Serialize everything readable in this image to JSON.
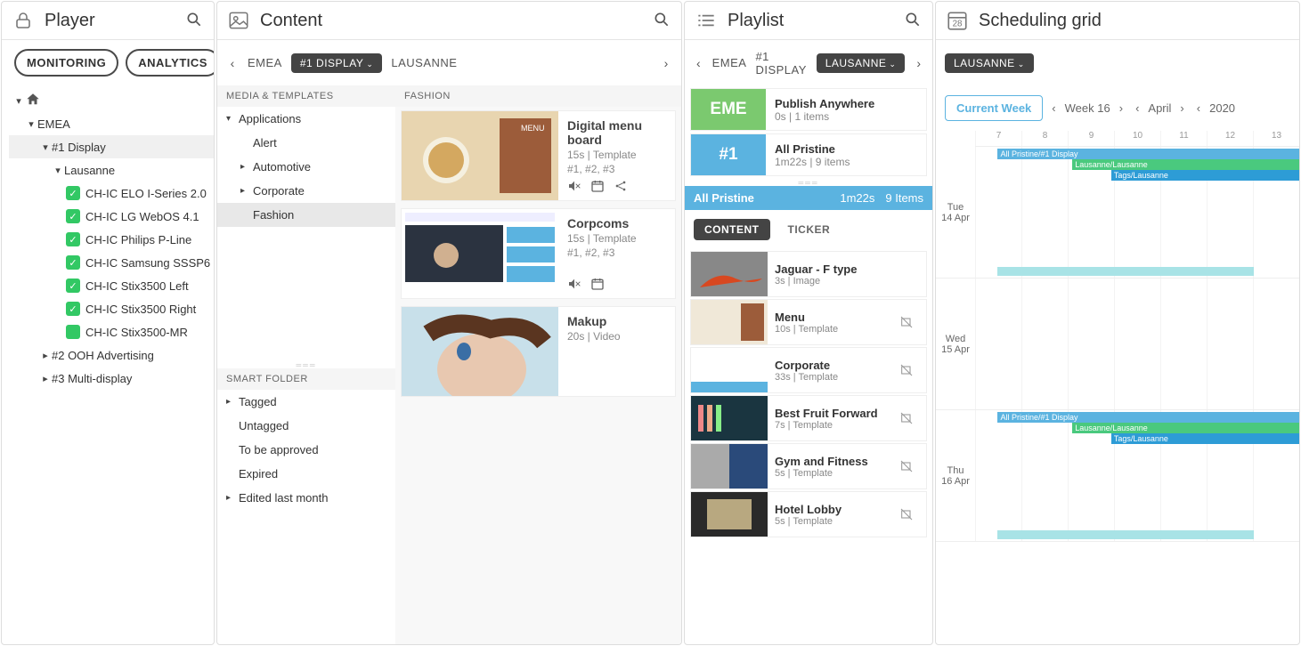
{
  "player": {
    "title": "Player",
    "monitoring": "MONITORING",
    "analytics": "ANALYTICS",
    "tree": {
      "emea": "EMEA",
      "d1": "#1 Display",
      "lausanne": "Lausanne",
      "devices": [
        "CH-IC ELO I-Series 2.0",
        "CH-IC LG WebOS 4.1",
        "CH-IC Philips P-Line",
        "CH-IC Samsung SSSP6",
        "CH-IC Stix3500 Left",
        "CH-IC Stix3500 Right",
        "CH-IC Stix3500-MR"
      ],
      "d2": "#2 OOH Advertising",
      "d3": "#3 Multi-display"
    }
  },
  "content": {
    "title": "Content",
    "crumbs": {
      "c1": "EMEA",
      "c2": "#1 DISPLAY",
      "c3": "LAUSANNE"
    },
    "sections": {
      "media": "MEDIA & TEMPLATES",
      "smart": "SMART FOLDER"
    },
    "media_folders": {
      "applications": "Applications",
      "alert": "Alert",
      "automotive": "Automotive",
      "corporate": "Corporate",
      "fashion": "Fashion"
    },
    "smart_folders": {
      "tagged": "Tagged",
      "untagged": "Untagged",
      "tobeapproved": "To be approved",
      "expired": "Expired",
      "edited": "Edited last month"
    },
    "fashion_hdr": "FASHION",
    "cards": [
      {
        "title": "Digital menu board",
        "meta1": "15s | Template",
        "meta2": "#1, #2, #3"
      },
      {
        "title": "Corpcoms",
        "meta1": "15s | Template",
        "meta2": "#1, #2, #3"
      },
      {
        "title": "Makup",
        "meta1": "20s | Video",
        "meta2": ""
      }
    ]
  },
  "playlist": {
    "title": "Playlist",
    "crumbs": {
      "c1": "EMEA",
      "c2": "#1 DISPLAY",
      "c3": "LAUSANNE"
    },
    "summary": [
      {
        "badge": "EME",
        "title": "Publish Anywhere",
        "meta": "0s | 1 items"
      },
      {
        "badge": "#1",
        "title": "All Pristine",
        "meta": "1m22s | 9 items"
      }
    ],
    "highlight": {
      "name": "All Pristine",
      "dur": "1m22s",
      "items": "9 Items"
    },
    "tabs": {
      "content": "CONTENT",
      "ticker": "TICKER"
    },
    "items": [
      {
        "title": "Jaguar - F type",
        "meta": "3s | Image"
      },
      {
        "title": "Menu",
        "meta": "10s | Template"
      },
      {
        "title": "Corporate",
        "meta": "33s | Template"
      },
      {
        "title": "Best Fruit Forward",
        "meta": "7s | Template"
      },
      {
        "title": "Gym and Fitness",
        "meta": "5s | Template"
      },
      {
        "title": "Hotel Lobby",
        "meta": "5s | Template"
      }
    ]
  },
  "grid": {
    "title": "Scheduling grid",
    "crumb": "LAUSANNE",
    "calnum": "28",
    "current_week": "Current Week",
    "week": "Week 16",
    "month": "April",
    "year": "2020",
    "hours": [
      "7",
      "8",
      "9",
      "10",
      "11",
      "12",
      "13"
    ],
    "days": [
      {
        "dow": "Tue",
        "date": "14 Apr"
      },
      {
        "dow": "Wed",
        "date": "15 Apr"
      },
      {
        "dow": "Thu",
        "date": "16 Apr"
      }
    ],
    "bands": {
      "b1": "All Pristine/#1 Display",
      "b2": "Lausanne/Lausanne",
      "b3": "Tags/Lausanne"
    }
  }
}
